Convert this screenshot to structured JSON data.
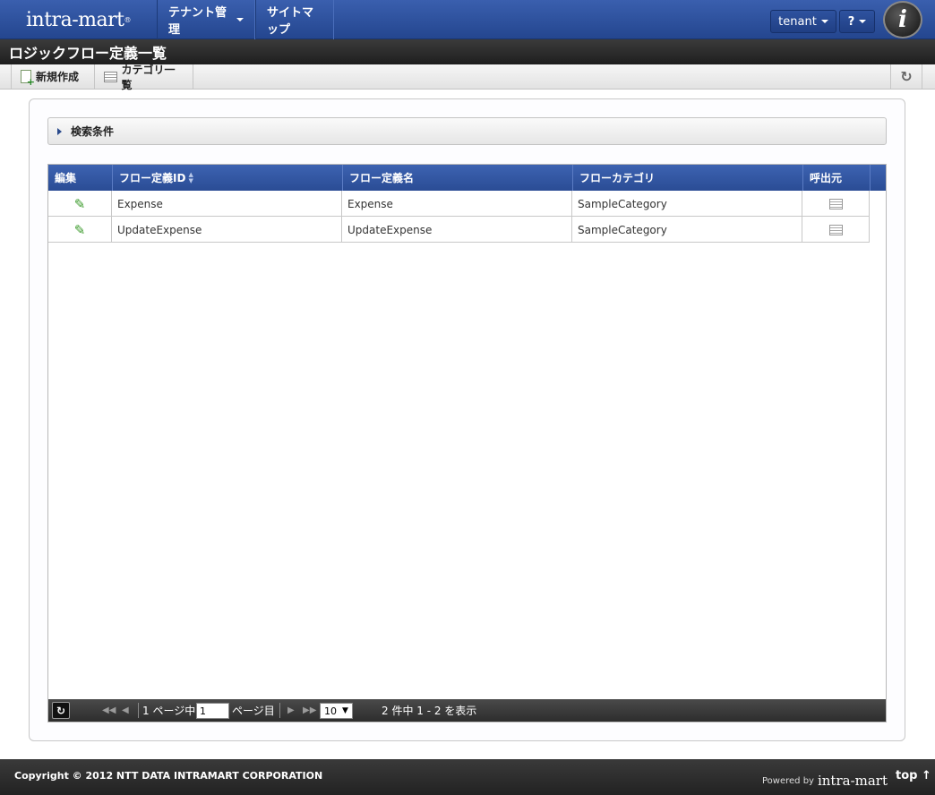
{
  "header": {
    "logo_text": "intra-mart",
    "nav": {
      "tenant_mgmt": "テナント管理",
      "sitemap": "サイトマップ"
    },
    "user_button": "tenant",
    "help_button": "?",
    "badge_letter": "i"
  },
  "page": {
    "title": "ロジックフロー定義一覧"
  },
  "toolbar": {
    "new_label": "新規作成",
    "category_list_label": "カテゴリ一覧"
  },
  "search": {
    "label": "検索条件"
  },
  "grid": {
    "columns": {
      "edit": "編集",
      "flow_id": "フロー定義ID",
      "flow_name": "フロー定義名",
      "flow_category": "フローカテゴリ",
      "caller": "呼出元"
    },
    "rows": [
      {
        "flow_id": "Expense",
        "flow_name": "Expense",
        "flow_category": "SampleCategory"
      },
      {
        "flow_id": "UpdateExpense",
        "flow_name": "UpdateExpense",
        "flow_category": "SampleCategory"
      }
    ]
  },
  "pager": {
    "page_prefix": "1 ページ中",
    "page_value": "1",
    "page_suffix": "ページ目",
    "page_size": "10",
    "info": "2 件中 1 - 2 を表示"
  },
  "footer": {
    "copyright": "Copyright © 2012 NTT DATA INTRAMART CORPORATION",
    "powered_by": "Powered by",
    "brand": "intra-mart",
    "top_link": "top ↑"
  }
}
